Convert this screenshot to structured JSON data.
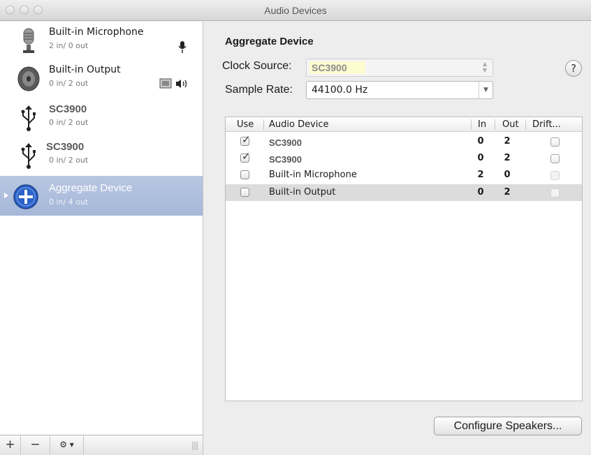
{
  "window": {
    "title": "Audio Devices"
  },
  "sidebar": {
    "devices": [
      {
        "name": "Built-in Microphone",
        "io": "2 in/ 0 out",
        "icon": "microphone-icon",
        "badge": "mic-badge-icon"
      },
      {
        "name": "Built-in Output",
        "io": "0 in/ 2 out",
        "icon": "speaker-icon",
        "badge": "output-badge-icon"
      },
      {
        "name": "SC3900",
        "io": "0 in/ 2 out",
        "icon": "usb-icon"
      },
      {
        "name": "SC3900",
        "io": "0 in/ 2 out",
        "icon": "usb-icon"
      },
      {
        "name": "Aggregate Device",
        "io": "0 in/ 4 out",
        "icon": "aggregate-plus-icon",
        "selected": true
      }
    ],
    "toolbar": {
      "add": "+",
      "remove": "−",
      "gear": "⚙ ▾",
      "grip": "|||"
    }
  },
  "detail": {
    "title": "Aggregate Device",
    "clock_source": {
      "label": "Clock Source:",
      "value": "SC3900"
    },
    "sample_rate": {
      "label": "Sample Rate:",
      "value": "44100.0 Hz"
    },
    "help": "?",
    "table": {
      "headers": {
        "use": "Use",
        "device": "Audio Device",
        "in": "In",
        "out": "Out",
        "drift": "Drift..."
      },
      "rows": [
        {
          "use": true,
          "device": "SC3900",
          "in": "0",
          "out": "2",
          "drift": false,
          "drift_enabled": true
        },
        {
          "use": true,
          "device": "SC3900",
          "in": "0",
          "out": "2",
          "drift": false,
          "drift_enabled": true
        },
        {
          "use": false,
          "device": "Built-in Microphone",
          "in": "2",
          "out": "0",
          "drift": false,
          "drift_enabled": false
        },
        {
          "use": false,
          "device": "Built-in Output",
          "in": "0",
          "out": "2",
          "drift": false,
          "drift_enabled": false,
          "highlighted": true
        }
      ]
    },
    "configure_button": "Configure Speakers..."
  },
  "colors": {
    "selection": "#a6b7d8",
    "highlight_row": "#dcdcdc",
    "clock_highlight": "#fdfbd0"
  }
}
